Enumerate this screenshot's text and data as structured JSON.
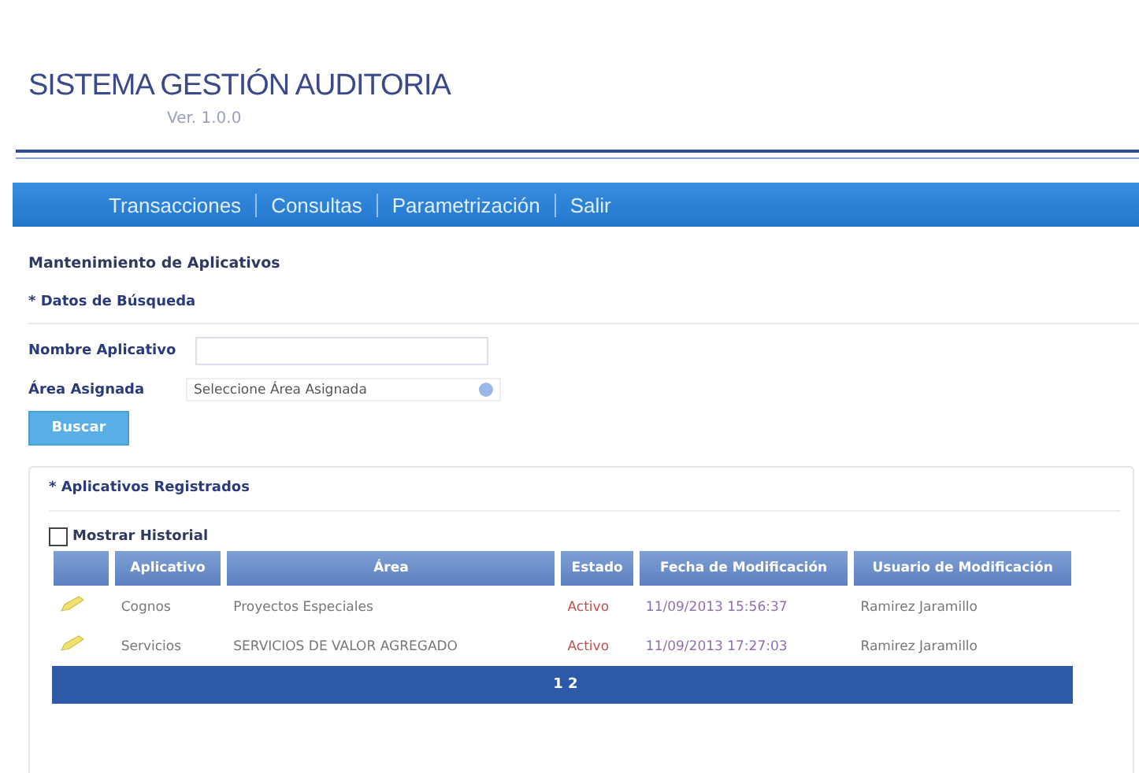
{
  "header": {
    "title": "SISTEMA GESTIÓN AUDITORIA",
    "subtitle": "Ver. 1.0.0"
  },
  "nav": [
    {
      "label": "Transacciones"
    },
    {
      "label": "Consultas"
    },
    {
      "label": "Parametrización"
    },
    {
      "label": "Salir"
    }
  ],
  "page_title": "Mantenimiento de Aplicativos",
  "search": {
    "title": "* Datos de Búsqueda",
    "name_label": "Nombre Aplicativo",
    "area_label": "Área Asignada",
    "area_value": "Seleccione Área Asignada",
    "button": "Buscar"
  },
  "results": {
    "title": "* Aplicativos Registrados",
    "history": {
      "label": "Mostrar Historial",
      "checked": false
    },
    "columns": [
      "Aplicativo",
      "Área",
      "Estado",
      "Fecha de Modificación",
      "Usuario de Modificación"
    ],
    "rows": [
      [
        "Cognos",
        "Proyectos Especiales",
        "Activo",
        "11/09/2013 15:56:37",
        "Ramirez Jaramillo"
      ],
      [
        "Servicios",
        "SERVICIOS DE VALOR AGREGADO",
        "Activo",
        "11/09/2013 17:27:03",
        "Ramirez Jaramillo"
      ]
    ],
    "pager": "1 2"
  }
}
